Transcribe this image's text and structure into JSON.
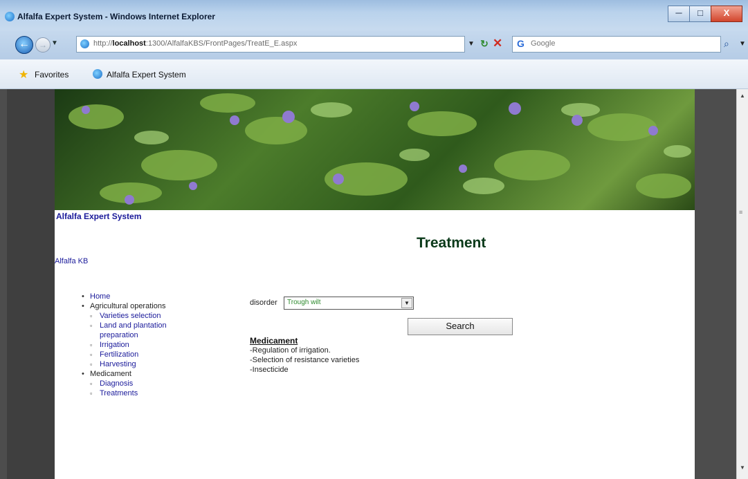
{
  "window": {
    "title": "Alfalfa Expert System - Windows Internet Explorer",
    "min": "─",
    "max": "□",
    "close": "X"
  },
  "address_bar": {
    "url_prefix": "http://",
    "url_host": "localhost",
    "url_rest": ":1300/AlfalfaKBS/FrontPages/TreatE_E.aspx"
  },
  "search": {
    "engine_label": "G",
    "placeholder": "Google"
  },
  "favorites": {
    "label": "Favorites",
    "tab_label": "Alfalfa Expert System"
  },
  "page": {
    "site_title": "Alfalfa Expert System",
    "heading": "Treatment",
    "kb_link": "Alfalfa KB",
    "menu": {
      "home": "Home",
      "agri": "Agricultural operations",
      "agri_items": [
        "Varieties selection",
        "Land and plantation preparation",
        "Irrigation",
        "Fertilization",
        "Harvesting"
      ],
      "medicament": "Medicament",
      "med_items": [
        "Diagnosis",
        "Treatments"
      ]
    },
    "disorder_label": "disorder",
    "disorder_value": "Trough wilt",
    "search_button": "Search",
    "medicament_title": "Medicament",
    "medicament_lines": [
      "-Regulation of irrigation.",
      "-Selection of resistance varieties",
      "-Insecticide"
    ]
  }
}
